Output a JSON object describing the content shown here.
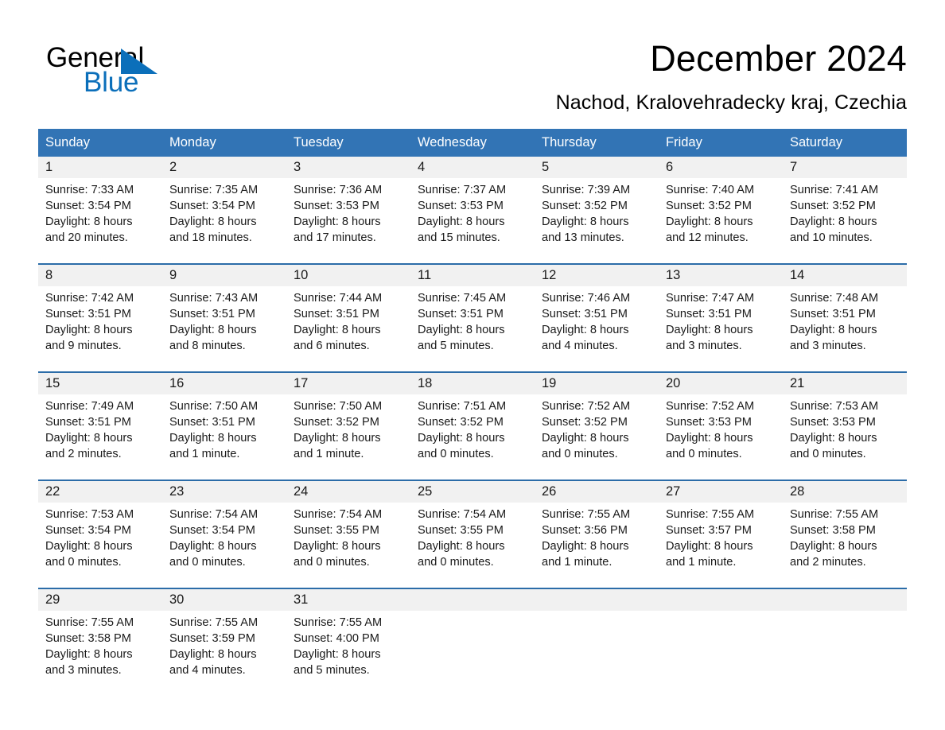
{
  "brand": {
    "name_primary": "General",
    "name_secondary": "Blue",
    "triangle_icon": "brand-triangle-icon",
    "primary_color": "#000000",
    "accent_color": "#0b6fba"
  },
  "header": {
    "title": "December 2024",
    "subtitle": "Nachod, Kralovehradecky kraj, Czechia"
  },
  "calendar": {
    "header_bg": "#3274b5",
    "row_rule_color": "#2b6ca8",
    "daynum_band_color": "#f1f1f1",
    "weekday_headers": [
      "Sunday",
      "Monday",
      "Tuesday",
      "Wednesday",
      "Thursday",
      "Friday",
      "Saturday"
    ],
    "weeks": [
      [
        {
          "day": "1",
          "sunrise": "Sunrise: 7:33 AM",
          "sunset": "Sunset: 3:54 PM",
          "daylight_line1": "Daylight: 8 hours",
          "daylight_line2": "and 20 minutes."
        },
        {
          "day": "2",
          "sunrise": "Sunrise: 7:35 AM",
          "sunset": "Sunset: 3:54 PM",
          "daylight_line1": "Daylight: 8 hours",
          "daylight_line2": "and 18 minutes."
        },
        {
          "day": "3",
          "sunrise": "Sunrise: 7:36 AM",
          "sunset": "Sunset: 3:53 PM",
          "daylight_line1": "Daylight: 8 hours",
          "daylight_line2": "and 17 minutes."
        },
        {
          "day": "4",
          "sunrise": "Sunrise: 7:37 AM",
          "sunset": "Sunset: 3:53 PM",
          "daylight_line1": "Daylight: 8 hours",
          "daylight_line2": "and 15 minutes."
        },
        {
          "day": "5",
          "sunrise": "Sunrise: 7:39 AM",
          "sunset": "Sunset: 3:52 PM",
          "daylight_line1": "Daylight: 8 hours",
          "daylight_line2": "and 13 minutes."
        },
        {
          "day": "6",
          "sunrise": "Sunrise: 7:40 AM",
          "sunset": "Sunset: 3:52 PM",
          "daylight_line1": "Daylight: 8 hours",
          "daylight_line2": "and 12 minutes."
        },
        {
          "day": "7",
          "sunrise": "Sunrise: 7:41 AM",
          "sunset": "Sunset: 3:52 PM",
          "daylight_line1": "Daylight: 8 hours",
          "daylight_line2": "and 10 minutes."
        }
      ],
      [
        {
          "day": "8",
          "sunrise": "Sunrise: 7:42 AM",
          "sunset": "Sunset: 3:51 PM",
          "daylight_line1": "Daylight: 8 hours",
          "daylight_line2": "and 9 minutes."
        },
        {
          "day": "9",
          "sunrise": "Sunrise: 7:43 AM",
          "sunset": "Sunset: 3:51 PM",
          "daylight_line1": "Daylight: 8 hours",
          "daylight_line2": "and 8 minutes."
        },
        {
          "day": "10",
          "sunrise": "Sunrise: 7:44 AM",
          "sunset": "Sunset: 3:51 PM",
          "daylight_line1": "Daylight: 8 hours",
          "daylight_line2": "and 6 minutes."
        },
        {
          "day": "11",
          "sunrise": "Sunrise: 7:45 AM",
          "sunset": "Sunset: 3:51 PM",
          "daylight_line1": "Daylight: 8 hours",
          "daylight_line2": "and 5 minutes."
        },
        {
          "day": "12",
          "sunrise": "Sunrise: 7:46 AM",
          "sunset": "Sunset: 3:51 PM",
          "daylight_line1": "Daylight: 8 hours",
          "daylight_line2": "and 4 minutes."
        },
        {
          "day": "13",
          "sunrise": "Sunrise: 7:47 AM",
          "sunset": "Sunset: 3:51 PM",
          "daylight_line1": "Daylight: 8 hours",
          "daylight_line2": "and 3 minutes."
        },
        {
          "day": "14",
          "sunrise": "Sunrise: 7:48 AM",
          "sunset": "Sunset: 3:51 PM",
          "daylight_line1": "Daylight: 8 hours",
          "daylight_line2": "and 3 minutes."
        }
      ],
      [
        {
          "day": "15",
          "sunrise": "Sunrise: 7:49 AM",
          "sunset": "Sunset: 3:51 PM",
          "daylight_line1": "Daylight: 8 hours",
          "daylight_line2": "and 2 minutes."
        },
        {
          "day": "16",
          "sunrise": "Sunrise: 7:50 AM",
          "sunset": "Sunset: 3:51 PM",
          "daylight_line1": "Daylight: 8 hours",
          "daylight_line2": "and 1 minute."
        },
        {
          "day": "17",
          "sunrise": "Sunrise: 7:50 AM",
          "sunset": "Sunset: 3:52 PM",
          "daylight_line1": "Daylight: 8 hours",
          "daylight_line2": "and 1 minute."
        },
        {
          "day": "18",
          "sunrise": "Sunrise: 7:51 AM",
          "sunset": "Sunset: 3:52 PM",
          "daylight_line1": "Daylight: 8 hours",
          "daylight_line2": "and 0 minutes."
        },
        {
          "day": "19",
          "sunrise": "Sunrise: 7:52 AM",
          "sunset": "Sunset: 3:52 PM",
          "daylight_line1": "Daylight: 8 hours",
          "daylight_line2": "and 0 minutes."
        },
        {
          "day": "20",
          "sunrise": "Sunrise: 7:52 AM",
          "sunset": "Sunset: 3:53 PM",
          "daylight_line1": "Daylight: 8 hours",
          "daylight_line2": "and 0 minutes."
        },
        {
          "day": "21",
          "sunrise": "Sunrise: 7:53 AM",
          "sunset": "Sunset: 3:53 PM",
          "daylight_line1": "Daylight: 8 hours",
          "daylight_line2": "and 0 minutes."
        }
      ],
      [
        {
          "day": "22",
          "sunrise": "Sunrise: 7:53 AM",
          "sunset": "Sunset: 3:54 PM",
          "daylight_line1": "Daylight: 8 hours",
          "daylight_line2": "and 0 minutes."
        },
        {
          "day": "23",
          "sunrise": "Sunrise: 7:54 AM",
          "sunset": "Sunset: 3:54 PM",
          "daylight_line1": "Daylight: 8 hours",
          "daylight_line2": "and 0 minutes."
        },
        {
          "day": "24",
          "sunrise": "Sunrise: 7:54 AM",
          "sunset": "Sunset: 3:55 PM",
          "daylight_line1": "Daylight: 8 hours",
          "daylight_line2": "and 0 minutes."
        },
        {
          "day": "25",
          "sunrise": "Sunrise: 7:54 AM",
          "sunset": "Sunset: 3:55 PM",
          "daylight_line1": "Daylight: 8 hours",
          "daylight_line2": "and 0 minutes."
        },
        {
          "day": "26",
          "sunrise": "Sunrise: 7:55 AM",
          "sunset": "Sunset: 3:56 PM",
          "daylight_line1": "Daylight: 8 hours",
          "daylight_line2": "and 1 minute."
        },
        {
          "day": "27",
          "sunrise": "Sunrise: 7:55 AM",
          "sunset": "Sunset: 3:57 PM",
          "daylight_line1": "Daylight: 8 hours",
          "daylight_line2": "and 1 minute."
        },
        {
          "day": "28",
          "sunrise": "Sunrise: 7:55 AM",
          "sunset": "Sunset: 3:58 PM",
          "daylight_line1": "Daylight: 8 hours",
          "daylight_line2": "and 2 minutes."
        }
      ],
      [
        {
          "day": "29",
          "sunrise": "Sunrise: 7:55 AM",
          "sunset": "Sunset: 3:58 PM",
          "daylight_line1": "Daylight: 8 hours",
          "daylight_line2": "and 3 minutes."
        },
        {
          "day": "30",
          "sunrise": "Sunrise: 7:55 AM",
          "sunset": "Sunset: 3:59 PM",
          "daylight_line1": "Daylight: 8 hours",
          "daylight_line2": "and 4 minutes."
        },
        {
          "day": "31",
          "sunrise": "Sunrise: 7:55 AM",
          "sunset": "Sunset: 4:00 PM",
          "daylight_line1": "Daylight: 8 hours",
          "daylight_line2": "and 5 minutes."
        },
        {
          "day": "",
          "sunrise": "",
          "sunset": "",
          "daylight_line1": "",
          "daylight_line2": ""
        },
        {
          "day": "",
          "sunrise": "",
          "sunset": "",
          "daylight_line1": "",
          "daylight_line2": ""
        },
        {
          "day": "",
          "sunrise": "",
          "sunset": "",
          "daylight_line1": "",
          "daylight_line2": ""
        },
        {
          "day": "",
          "sunrise": "",
          "sunset": "",
          "daylight_line1": "",
          "daylight_line2": ""
        }
      ]
    ]
  }
}
